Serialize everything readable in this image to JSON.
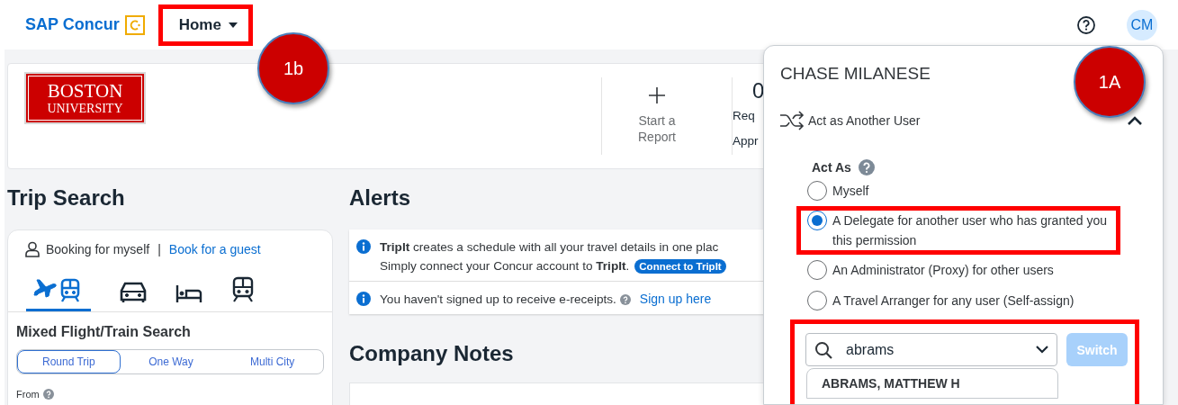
{
  "header": {
    "brand": "SAP Concur",
    "home_menu": {
      "label": "Home",
      "highlighted": true
    },
    "avatar": "CM"
  },
  "hero": {
    "logo_lines": [
      "BOSTON",
      "UNIVERSITY"
    ],
    "tiles": [
      {
        "kind": "action",
        "lines": [
          "Start a",
          "Report"
        ]
      },
      {
        "kind": "count",
        "count": "0",
        "lines": [
          "Req",
          "Appr"
        ]
      }
    ]
  },
  "trip_search": {
    "title": "Trip Search",
    "booking_for": "Booking for myself",
    "separator": "|",
    "guest_link": "Book for a guest",
    "modes": [
      {
        "kind": "flight-train",
        "selected": true
      },
      {
        "kind": "car",
        "selected": false
      },
      {
        "kind": "hotel",
        "selected": false
      },
      {
        "kind": "train",
        "selected": false
      }
    ],
    "search_title": "Mixed Flight/Train Search",
    "trip_types": [
      {
        "label": "Round Trip",
        "selected": true
      },
      {
        "label": "One Way",
        "selected": false
      },
      {
        "label": "Multi City",
        "selected": false
      }
    ],
    "from_label": "From"
  },
  "alerts": {
    "title": "Alerts",
    "items": [
      {
        "lines": [
          "**TripIt** creates a schedule with all your travel details in one plac",
          "Simply connect your Concur account to **TripIt**."
        ],
        "button": "Connect to TripIt"
      },
      {
        "lines": [
          "You haven't signed up to receive e-receipts."
        ],
        "help": true,
        "link": "Sign up here"
      }
    ]
  },
  "company_notes": {
    "title": "Company Notes"
  },
  "account_menu": {
    "name": "CHASE MILANESE",
    "section": "Act as Another User",
    "expanded": true,
    "act_as_label": "Act As",
    "options": [
      {
        "label": "Myself",
        "selected": false,
        "highlighted": false
      },
      {
        "label": "A Delegate for another user who has granted you this permission",
        "selected": true,
        "highlighted": true
      },
      {
        "label": "An Administrator (Proxy) for other users",
        "selected": false,
        "highlighted": false
      },
      {
        "label": "A Travel Arranger for any user (Self-assign)",
        "selected": false,
        "highlighted": false
      }
    ],
    "search": {
      "value": "abrams",
      "highlighted": true
    },
    "switch_button": {
      "label": "Switch",
      "disabled": true
    },
    "results": [
      "ABRAMS, MATTHEW H"
    ]
  },
  "callouts": [
    {
      "label": "1b",
      "kind": "home"
    },
    {
      "label": "1A",
      "kind": "menu"
    }
  ]
}
